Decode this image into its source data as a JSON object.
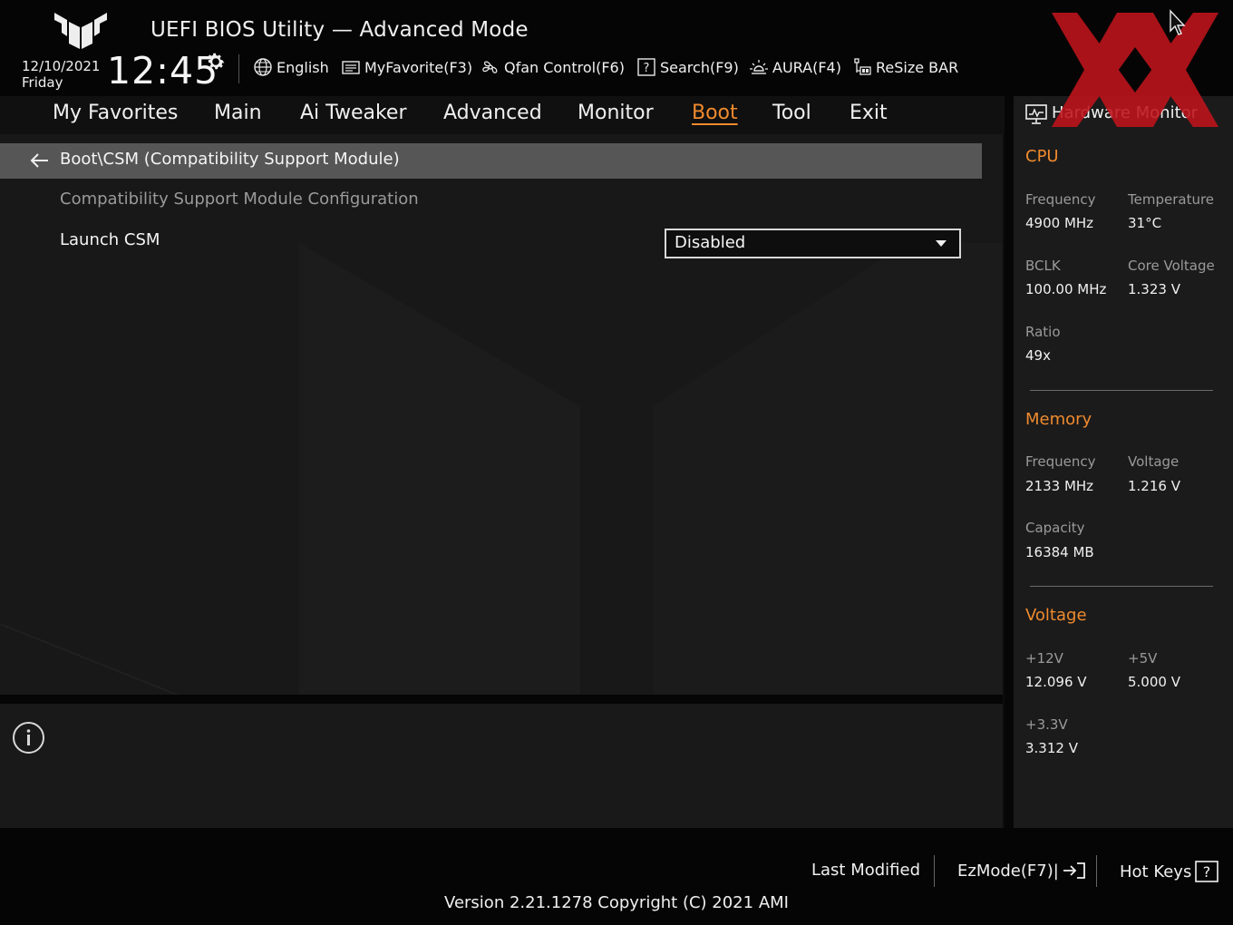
{
  "header": {
    "app_title": "UEFI BIOS Utility — Advanced Mode",
    "date": "12/10/2021",
    "day": "Friday",
    "time": "12:45",
    "toolbar": {
      "language": "English",
      "myfavorite": "MyFavorite(F3)",
      "qfan": "Qfan Control(F6)",
      "search": "Search(F9)",
      "aura": "AURA(F4)",
      "resize_bar": "ReSize BAR"
    }
  },
  "menu": {
    "items": [
      "My Favorites",
      "Main",
      "Ai Tweaker",
      "Advanced",
      "Monitor",
      "Boot",
      "Tool",
      "Exit"
    ],
    "active": "Boot"
  },
  "main": {
    "breadcrumb": "Boot\\CSM (Compatibility Support Module)",
    "section_title": "Compatibility Support Module Configuration",
    "settings": [
      {
        "label": "Launch CSM",
        "value": "Disabled"
      }
    ]
  },
  "hw_monitor": {
    "title": "Hardware Monitor",
    "cpu": {
      "section": "CPU",
      "frequency_label": "Frequency",
      "frequency": "4900 MHz",
      "temperature_label": "Temperature",
      "temperature": "31°C",
      "bclk_label": "BCLK",
      "bclk": "100.00 MHz",
      "core_voltage_label": "Core Voltage",
      "core_voltage": "1.323 V",
      "ratio_label": "Ratio",
      "ratio": "49x"
    },
    "memory": {
      "section": "Memory",
      "frequency_label": "Frequency",
      "frequency": "2133 MHz",
      "voltage_label": "Voltage",
      "voltage": "1.216 V",
      "capacity_label": "Capacity",
      "capacity": "16384 MB"
    },
    "voltage": {
      "section": "Voltage",
      "v12_label": "+12V",
      "v12": "12.096 V",
      "v5_label": "+5V",
      "v5": "5.000 V",
      "v33_label": "+3.3V",
      "v33": "3.312 V"
    }
  },
  "footer": {
    "last_modified": "Last Modified",
    "ezmode": "EzMode(F7)|",
    "hot_keys": "Hot Keys",
    "version": "Version 2.21.1278 Copyright (C) 2021 AMI"
  },
  "colors": {
    "accent": "#f08a2e",
    "watermark": "#c0141c",
    "background": "#0c0c0c",
    "panel": "#181818"
  }
}
